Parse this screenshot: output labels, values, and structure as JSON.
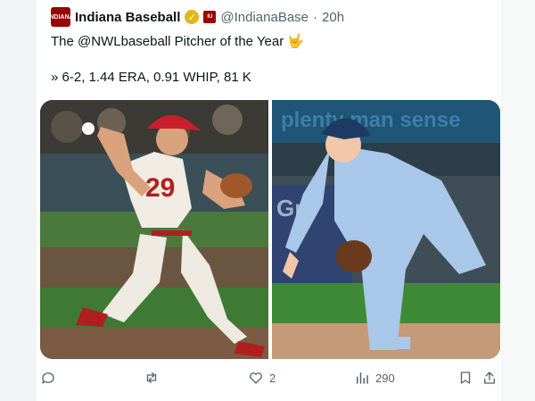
{
  "tweet": {
    "display_name": "Indiana Baseball",
    "handle": "@IndianaBase",
    "separator": "·",
    "time": "20h",
    "logo_text": "INDIANA",
    "text_line1": "The @NWLbaseball Pitcher of the Year",
    "emoji": "🤟",
    "text_line2": "» 6-2, 1.44 ERA, 0.91 WHIP, 81 K",
    "jersey_number": "29"
  },
  "actions": {
    "reply_count": "",
    "retweet_count": "",
    "like_count": "2",
    "views_count": "290"
  },
  "colors": {
    "brand": "#990000",
    "verified": "#e2b719",
    "text": "#0f1419",
    "muted": "#536471"
  }
}
